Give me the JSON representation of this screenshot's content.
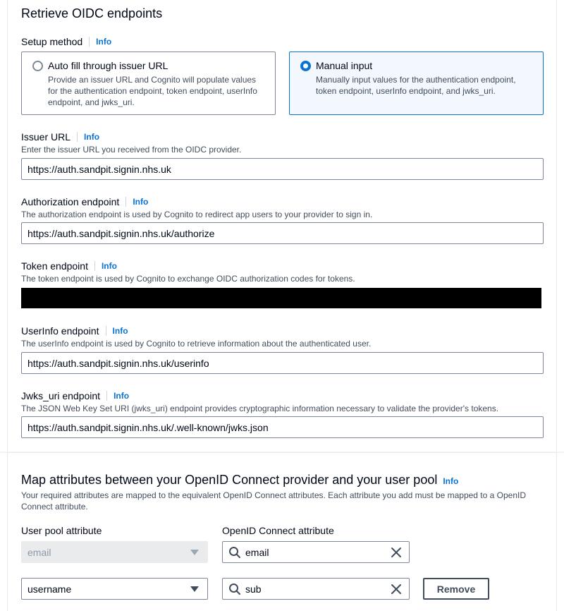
{
  "oidc": {
    "section_title": "Retrieve OIDC endpoints",
    "setup_method_label": "Setup method",
    "info": "Info",
    "auto": {
      "title": "Auto fill through issuer URL",
      "desc": "Provide an issuer URL and Cognito will populate values for the authentication endpoint, token endpoint, userInfo endpoint, and jwks_uri."
    },
    "manual": {
      "title": "Manual input",
      "desc": "Manually input values for the authentication endpoint, token endpoint, userInfo endpoint, and jwks_uri."
    },
    "issuer": {
      "label": "Issuer URL",
      "desc": "Enter the issuer URL you received from the OIDC provider.",
      "value": "https://auth.sandpit.signin.nhs.uk"
    },
    "authorization": {
      "label": "Authorization endpoint",
      "desc": "The authorization endpoint is used by Cognito to redirect app users to your provider to sign in.",
      "value": "https://auth.sandpit.signin.nhs.uk/authorize"
    },
    "token": {
      "label": "Token endpoint",
      "desc": "The token endpoint is used by Cognito to exchange OIDC authorization codes for tokens."
    },
    "userinfo": {
      "label": "UserInfo endpoint",
      "desc": "The userInfo endpoint is used by Cognito to retrieve information about the authenticated user.",
      "value": "https://auth.sandpit.signin.nhs.uk/userinfo"
    },
    "jwks": {
      "label": "Jwks_uri endpoint",
      "desc": "The JSON Web Key Set URI (jwks_uri) endpoint provides cryptographic information necessary to validate the provider's tokens.",
      "value": "https://auth.sandpit.signin.nhs.uk/.well-known/jwks.json"
    }
  },
  "mapping": {
    "title": "Map attributes between your OpenID Connect provider and your user pool",
    "info": "Info",
    "desc": "Your required attributes are mapped to the equivalent OpenID Connect attributes. Each attribute you add must be mapped to a OpenID Connect attribute.",
    "col_user_pool": "User pool attribute",
    "col_oidc": "OpenID Connect attribute",
    "rows": [
      {
        "user_pool": "email",
        "oidc": "email"
      },
      {
        "user_pool": "username",
        "oidc": "sub",
        "remove": "Remove"
      }
    ]
  },
  "colors": {
    "accent": "#0972d3",
    "text": "#000716",
    "muted": "#414d5c"
  }
}
